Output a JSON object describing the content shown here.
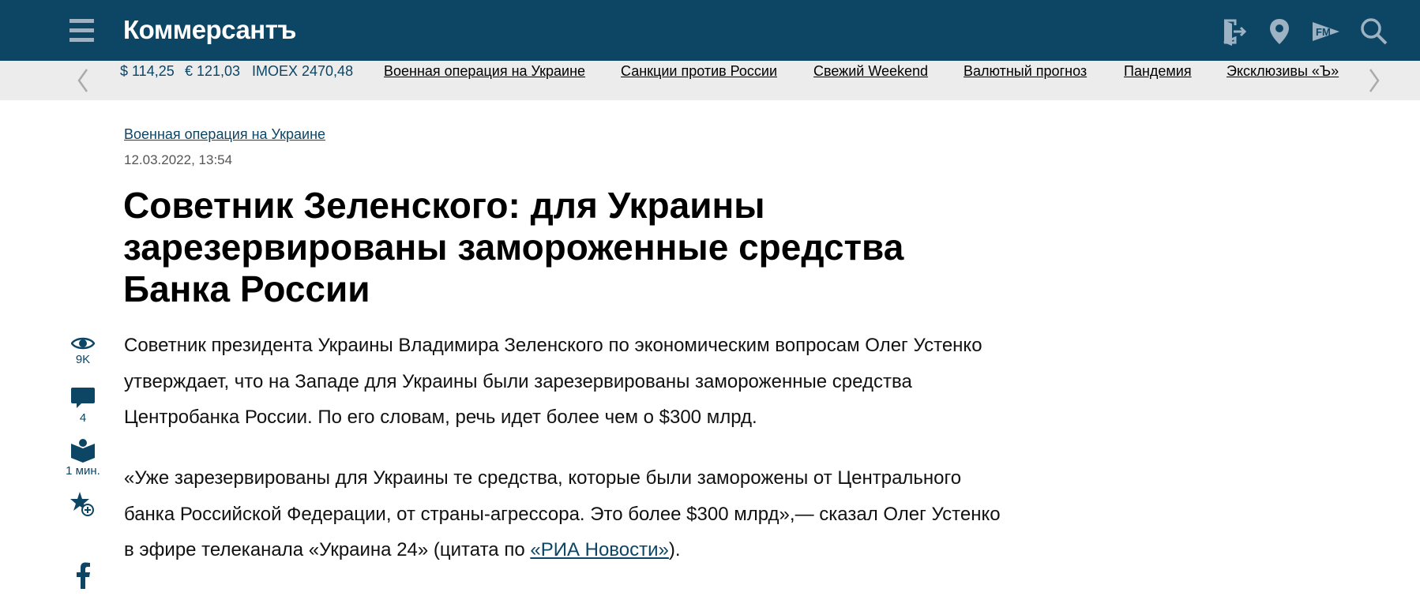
{
  "header": {
    "logo": "Коммерсантъ",
    "icons": [
      "menu-icon",
      "login-icon",
      "location-icon",
      "radio-fm-icon",
      "search-icon"
    ]
  },
  "ticker": {
    "usd": "$ 114,25",
    "eur": "€ 121,03",
    "imoex": "IMOEX 2470,48"
  },
  "nav": {
    "links": [
      "Военная операция на Украине",
      "Санкции против России",
      "Свежий Weekend",
      "Валютный прогноз",
      "Пандемия",
      "Эксклюзивы «Ъ»"
    ]
  },
  "article": {
    "rubric": "Военная операция на Украине",
    "date": "12.03.2022, 13:54",
    "title": "Советник Зеленского: для Украины зарезервированы замороженные средства Банка России",
    "p1": "Советник президента Украины Владимира Зеленского по экономическим вопросам Олег Устенко утверждает, что на Западе для Украины были зарезервированы замороженные средства Центробанка России. По его словам, речь идет более чем о $300 млрд.",
    "p2_text": "«Уже зарезервированы для Украины те средства, которые были заморожены от Центрального банка Российской Федерации, от страны-агрессора. Это более $300 млрд»,— сказал Олег Устенко в эфире телеканала «Украина 24» (цитата по ",
    "p2_link": "«РИА Новости»",
    "p2_end": ")."
  },
  "sidebar": {
    "views": "9K",
    "comments": "4",
    "read_time": "1 мин."
  },
  "colors": {
    "header_bg": "#0d4565",
    "strip_bg": "#ececec",
    "accent": "#0d4565"
  }
}
